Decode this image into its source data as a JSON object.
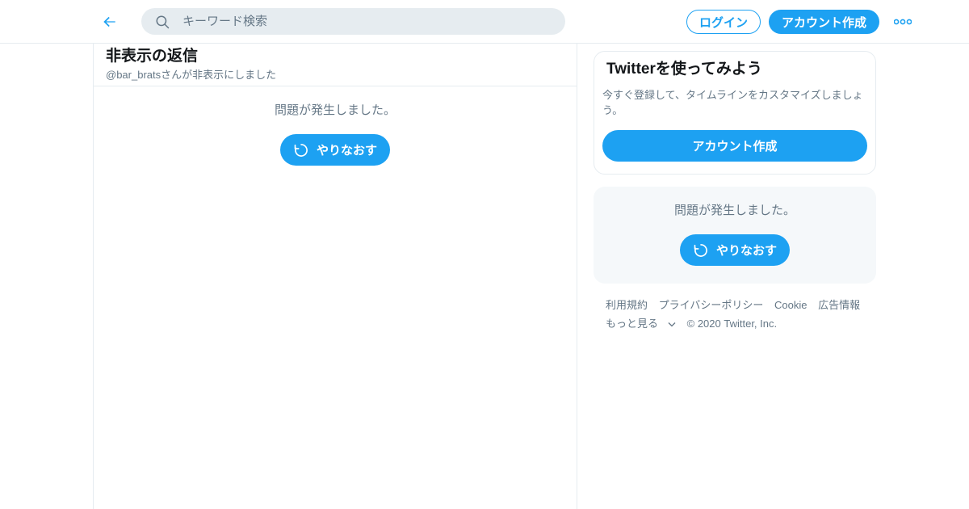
{
  "header": {
    "search_placeholder": "キーワード検索",
    "login_label": "ログイン",
    "signup_label": "アカウント作成"
  },
  "main": {
    "title": "非表示の返信",
    "subtitle": "@bar_bratsさんが非表示にしました",
    "error_text": "問題が発生しました。",
    "retry_label": "やりなおす"
  },
  "sidebar": {
    "signup_card": {
      "title": "Twitterを使ってみよう",
      "description": "今すぐ登録して、タイムラインをカスタマイズしましょう。",
      "button_label": "アカウント作成"
    },
    "trends_error": {
      "error_text": "問題が発生しました。",
      "retry_label": "やりなおす"
    },
    "footer": {
      "links": [
        "利用規約",
        "プライバシーポリシー",
        "Cookie",
        "広告情報"
      ],
      "more_label": "もっと見る",
      "copyright": "© 2020 Twitter, Inc."
    }
  },
  "colors": {
    "accent": "#1da1f2",
    "secondary_text": "#657786",
    "border": "#e6ecf0",
    "panel_bg": "#f5f8fa"
  }
}
